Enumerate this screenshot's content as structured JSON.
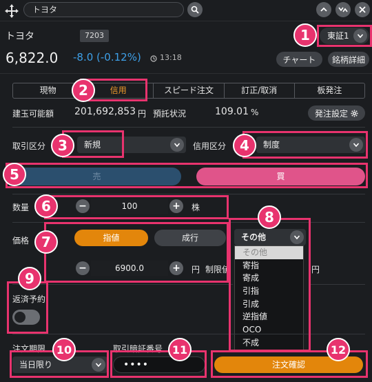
{
  "search": {
    "value": "トヨタ"
  },
  "stock": {
    "name": "トヨタ",
    "code": "7203",
    "price": "6,822.0",
    "change": "-8.0 (-0.12%)",
    "time": "13:18",
    "market": "東証1"
  },
  "buttons": {
    "chart": "チャート",
    "details": "銘柄詳細",
    "order_settings": "発注設定",
    "confirm": "注文確認"
  },
  "tabs": [
    "現物",
    "信用",
    "スピード注文",
    "訂正/取消",
    "板発注"
  ],
  "margin": {
    "label": "建玉可能額",
    "value": "201,692,853",
    "unit": "円",
    "deposit_label": "預託状況",
    "deposit_value": "109.01",
    "deposit_unit": "%"
  },
  "trade": {
    "label": "取引区分",
    "value": "新規",
    "credit_label": "信用区分",
    "credit_value": "制度"
  },
  "side": {
    "sell": "売",
    "buy": "買"
  },
  "quantity": {
    "label": "数量",
    "value": "100",
    "unit": "株"
  },
  "price": {
    "label": "価格",
    "limit": "指値",
    "market": "成行",
    "other": "その他",
    "value": "6900.0",
    "unit": "円",
    "limit_note_a": "制限値",
    "limit_note_b": "円"
  },
  "dropdown": [
    "その他",
    "寄指",
    "寄成",
    "引指",
    "引成",
    "逆指値",
    "OCO",
    "不成"
  ],
  "repay": {
    "label": "返済予約"
  },
  "expiry": {
    "label": "注文期限",
    "value": "当日限り"
  },
  "pin": {
    "label": "取引暗証番号",
    "value": "••••"
  },
  "badges": [
    "1",
    "2",
    "3",
    "4",
    "5",
    "6",
    "7",
    "8",
    "9",
    "10",
    "11",
    "12"
  ],
  "colors": {
    "accent": "#ef9a2b",
    "highlight": "#e8336e",
    "sell": "#2b4f6e",
    "buy": "#e0548a",
    "change": "#3ea0e8"
  }
}
